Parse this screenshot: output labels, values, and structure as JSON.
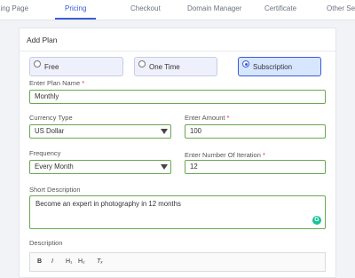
{
  "tabs": [
    "ding Page",
    "Pricing",
    "Checkout",
    "Domain Manager",
    "Certificate",
    "Other Sett"
  ],
  "card": {
    "title": "Add Plan"
  },
  "plan_types": [
    {
      "label": "Free",
      "selected": false
    },
    {
      "label": "One Time",
      "selected": false
    },
    {
      "label": "Subscription",
      "selected": true
    }
  ],
  "fields": {
    "plan_name": {
      "label": "Enter Plan Name",
      "required_mark": "*",
      "value": "Monthly"
    },
    "currency": {
      "label": "Currency Type",
      "value": "US Dollar"
    },
    "amount": {
      "label": "Enter Amount",
      "required_mark": "*",
      "value": "100"
    },
    "frequency": {
      "label": "Frequency",
      "value": "Every Month"
    },
    "iteration": {
      "label": "Enter Number Of Iteration",
      "required_mark": "*",
      "value": "12"
    },
    "short_description": {
      "label": "Short Description",
      "value": "Become an expert in photography in 12 months"
    },
    "description": {
      "label": "Description"
    }
  },
  "toolbar": {
    "bold": "B",
    "italic": "I",
    "h1": "H₁",
    "h2": "H₂",
    "clear": "Tₓ"
  },
  "colors": {
    "accent": "#3b5bdb",
    "valid_border": "#6aa84f",
    "required": "#e03131"
  },
  "icons": {
    "grammar": "grammarly-icon"
  }
}
